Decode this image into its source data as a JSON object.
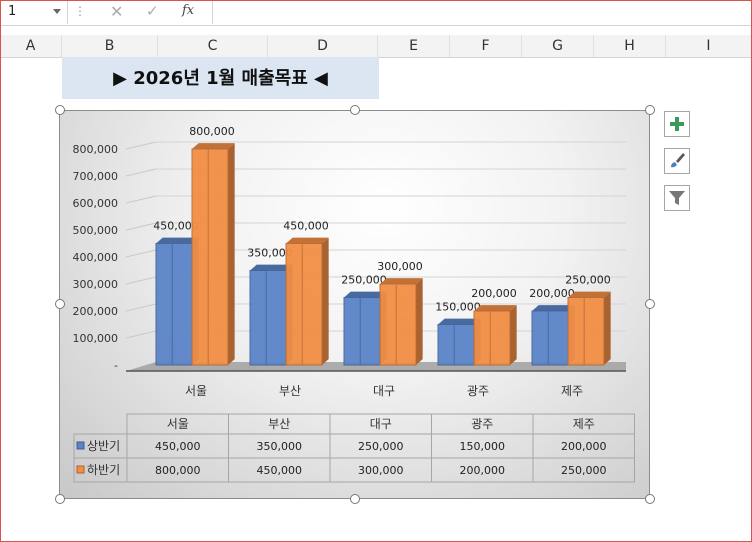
{
  "formula_bar": {
    "name_box": "1",
    "fx_label": "fx",
    "formula": ""
  },
  "columns": [
    "A",
    "B",
    "C",
    "D",
    "E",
    "F",
    "G",
    "H",
    "I"
  ],
  "title_cell": "▶ 2026년 1월 매출목표 ◀",
  "colors": {
    "series1": "#5b84c8",
    "series2": "#f28e45",
    "title_fill": "#dce6f2"
  },
  "chart_data": {
    "type": "bar",
    "categories": [
      "서울",
      "부산",
      "대구",
      "광주",
      "제주"
    ],
    "series": [
      {
        "name": "상반기",
        "values": [
          450000,
          350000,
          250000,
          150000,
          200000
        ]
      },
      {
        "name": "하반기",
        "values": [
          800000,
          450000,
          300000,
          200000,
          250000
        ]
      }
    ],
    "value_labels": [
      [
        "450,000",
        "350,000",
        "250,000",
        "150,000",
        "200,000"
      ],
      [
        "800,000",
        "450,000",
        "300,000",
        "200,000",
        "250,000"
      ]
    ],
    "y_ticks": [
      "-",
      "100,000",
      "200,000",
      "300,000",
      "400,000",
      "500,000",
      "600,000",
      "700,000",
      "800,000"
    ],
    "ylim": [
      0,
      800000
    ],
    "data_table": true,
    "title": "",
    "xlabel": "",
    "ylabel": ""
  },
  "chart_tools": [
    "plus-icon",
    "brush-icon",
    "filter-icon"
  ]
}
